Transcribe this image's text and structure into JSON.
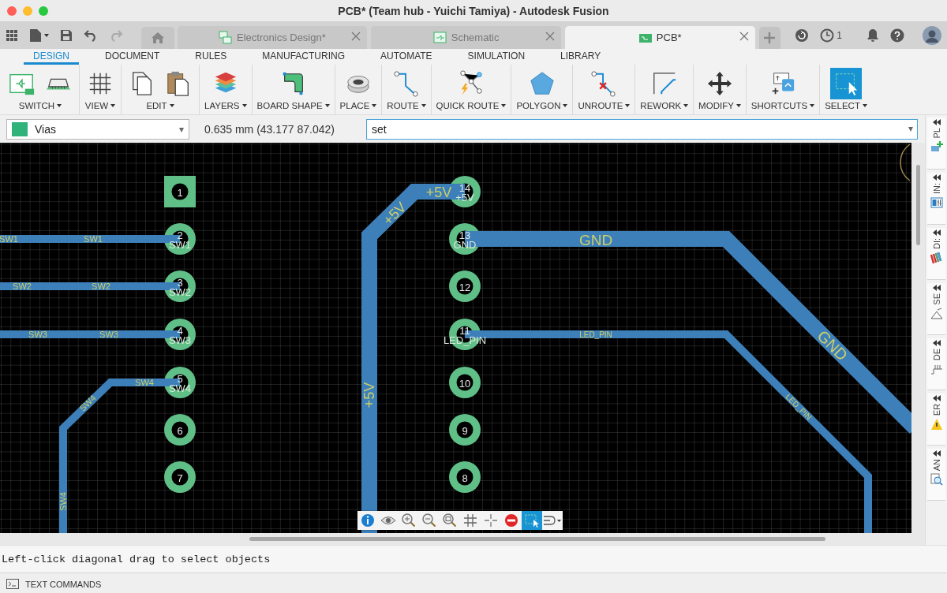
{
  "window": {
    "title": "PCB* (Team hub - Yuichi Tamiya) - Autodesk Fusion"
  },
  "document_tabs": [
    {
      "label": "Electronics Design*",
      "kind": "design",
      "selected": false
    },
    {
      "label": "Schematic",
      "kind": "schematic",
      "selected": false
    },
    {
      "label": "PCB*",
      "kind": "pcb",
      "selected": true
    }
  ],
  "job_status": {
    "count": "1"
  },
  "ribbon_tabs": [
    {
      "label": "DESIGN",
      "selected": true
    },
    {
      "label": "DOCUMENT",
      "selected": false
    },
    {
      "label": "RULES",
      "selected": false
    },
    {
      "label": "MANUFACTURING",
      "selected": false
    },
    {
      "label": "AUTOMATE",
      "selected": false
    },
    {
      "label": "SIMULATION",
      "selected": false
    },
    {
      "label": "LIBRARY",
      "selected": false
    }
  ],
  "tool_groups": [
    {
      "label": "SWITCH",
      "kind": "switch",
      "selected": false
    },
    {
      "label": "VIEW",
      "kind": "view",
      "selected": false
    },
    {
      "label": "EDIT",
      "kind": "edit",
      "selected": false
    },
    {
      "label": "LAYERS",
      "kind": "layers",
      "selected": false
    },
    {
      "label": "BOARD SHAPE",
      "kind": "board",
      "selected": false
    },
    {
      "label": "PLACE",
      "kind": "place",
      "selected": false
    },
    {
      "label": "ROUTE",
      "kind": "route",
      "selected": false
    },
    {
      "label": "QUICK ROUTE",
      "kind": "quickroute",
      "selected": false
    },
    {
      "label": "POLYGON",
      "kind": "polygon",
      "selected": false
    },
    {
      "label": "UNROUTE",
      "kind": "unroute",
      "selected": false
    },
    {
      "label": "REWORK",
      "kind": "rework",
      "selected": false
    },
    {
      "label": "MODIFY",
      "kind": "modify",
      "selected": false
    },
    {
      "label": "SHORTCUTS",
      "kind": "shortcuts",
      "selected": false
    },
    {
      "label": "SELECT",
      "kind": "select",
      "selected": true
    }
  ],
  "layer_selector": {
    "value": "Vias",
    "color": "#2fb37a"
  },
  "coordinates": "0.635 mm (43.177 87.042)",
  "command_field": {
    "value": "set"
  },
  "canvas": {
    "pads": [
      {
        "number": "1",
        "kind": "square"
      },
      {
        "number": "2",
        "kind": "round",
        "net": "SW1"
      },
      {
        "number": "3",
        "kind": "round",
        "net": "SW2"
      },
      {
        "number": "4",
        "kind": "round",
        "net": "SW3"
      },
      {
        "number": "5",
        "kind": "round",
        "net": "SW4"
      },
      {
        "number": "6",
        "kind": "round"
      },
      {
        "number": "7",
        "kind": "round"
      },
      {
        "number": "14",
        "kind": "round",
        "net": "+5V"
      },
      {
        "number": "13",
        "kind": "round",
        "net": "GND"
      },
      {
        "number": "12",
        "kind": "round"
      },
      {
        "number": "11",
        "kind": "round",
        "net": "LED_PIN"
      },
      {
        "number": "10",
        "kind": "round"
      },
      {
        "number": "9",
        "kind": "round"
      },
      {
        "number": "8",
        "kind": "round"
      }
    ],
    "traces": [
      {
        "kind": "signal",
        "labels": [
          "SW1",
          "SW1"
        ]
      },
      {
        "kind": "signal",
        "labels": [
          "SW2",
          "SW2"
        ]
      },
      {
        "kind": "signal",
        "labels": [
          "SW3",
          "SW3"
        ]
      },
      {
        "kind": "signal",
        "labels": [
          "SW4",
          "SW4",
          "SW4"
        ]
      },
      {
        "kind": "power",
        "labels": [
          "+5V",
          "+5V",
          "+5V"
        ]
      },
      {
        "kind": "power",
        "labels": [
          "GND",
          "GND"
        ]
      },
      {
        "kind": "signal",
        "labels": [
          "LED_PIN",
          "LED_PIN"
        ]
      }
    ]
  },
  "canvas_toolbar": [
    {
      "kind": "info",
      "selected": false
    },
    {
      "kind": "eye",
      "selected": false
    },
    {
      "kind": "zoomin",
      "selected": false
    },
    {
      "kind": "zoomout",
      "selected": false
    },
    {
      "kind": "zoomfit",
      "selected": false
    },
    {
      "kind": "grid",
      "selected": false
    },
    {
      "kind": "cross",
      "selected": false
    },
    {
      "kind": "stop",
      "selected": false
    },
    {
      "kind": "select",
      "selected": true
    },
    {
      "kind": "route",
      "selected": false
    }
  ],
  "side_panels": [
    {
      "label": "PL",
      "kind": "place"
    },
    {
      "label": "IN:",
      "kind": "inspect"
    },
    {
      "label": "DI:",
      "kind": "display"
    },
    {
      "label": "SE",
      "kind": "selection"
    },
    {
      "label": "DE",
      "kind": "design"
    },
    {
      "label": "ER",
      "kind": "error"
    },
    {
      "label": "AN",
      "kind": "analyze"
    }
  ],
  "status_message": "Left-click diagonal drag to select objects",
  "text_commands": {
    "label": "TEXT COMMANDS"
  }
}
